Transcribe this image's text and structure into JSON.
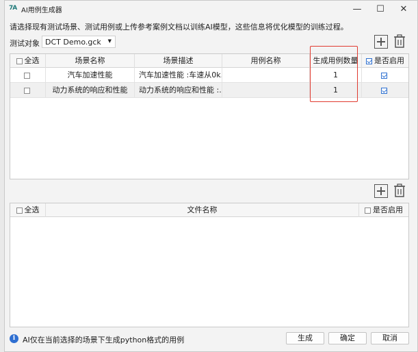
{
  "window": {
    "icon": "ai-logo-icon",
    "title": "AI用例生成器",
    "min_glyph": "—",
    "max_glyph": "☐",
    "close_glyph": "✕"
  },
  "instructions": "请选择现有测试场景、测试用例或上传参考案例文档以训练AI模型，这些信息将优化模型的训练过程。",
  "target": {
    "label": "测试对象",
    "value": "DCT Demo.gck"
  },
  "scenario_table": {
    "headers": {
      "select_all": "全选",
      "name": "场景名称",
      "desc": "场景描述",
      "case_name": "用例名称",
      "count": "生成用例数量",
      "enabled": "是否启用"
    },
    "select_all_checked": false,
    "enabled_header_checked": true,
    "rows": [
      {
        "checked": false,
        "name": "汽车加速性能",
        "desc": "汽车加速性能 :车速从0k...",
        "case_name": "",
        "count": "1",
        "enabled": true
      },
      {
        "checked": false,
        "name": "动力系统的响应和性能",
        "desc": "动力系统的响应和性能 :...",
        "case_name": "",
        "count": "1",
        "enabled": true
      }
    ]
  },
  "file_table": {
    "headers": {
      "select_all": "全选",
      "file_name": "文件名称",
      "enabled": "是否启用"
    }
  },
  "footer": {
    "info": "AI仅在当前选择的场景下生成python格式的用例",
    "generate": "生成",
    "confirm": "确定",
    "cancel": "取消"
  },
  "colors": {
    "accent": "#2c6fd0",
    "highlight": "#e0392e",
    "info": "#2f6fd1"
  }
}
